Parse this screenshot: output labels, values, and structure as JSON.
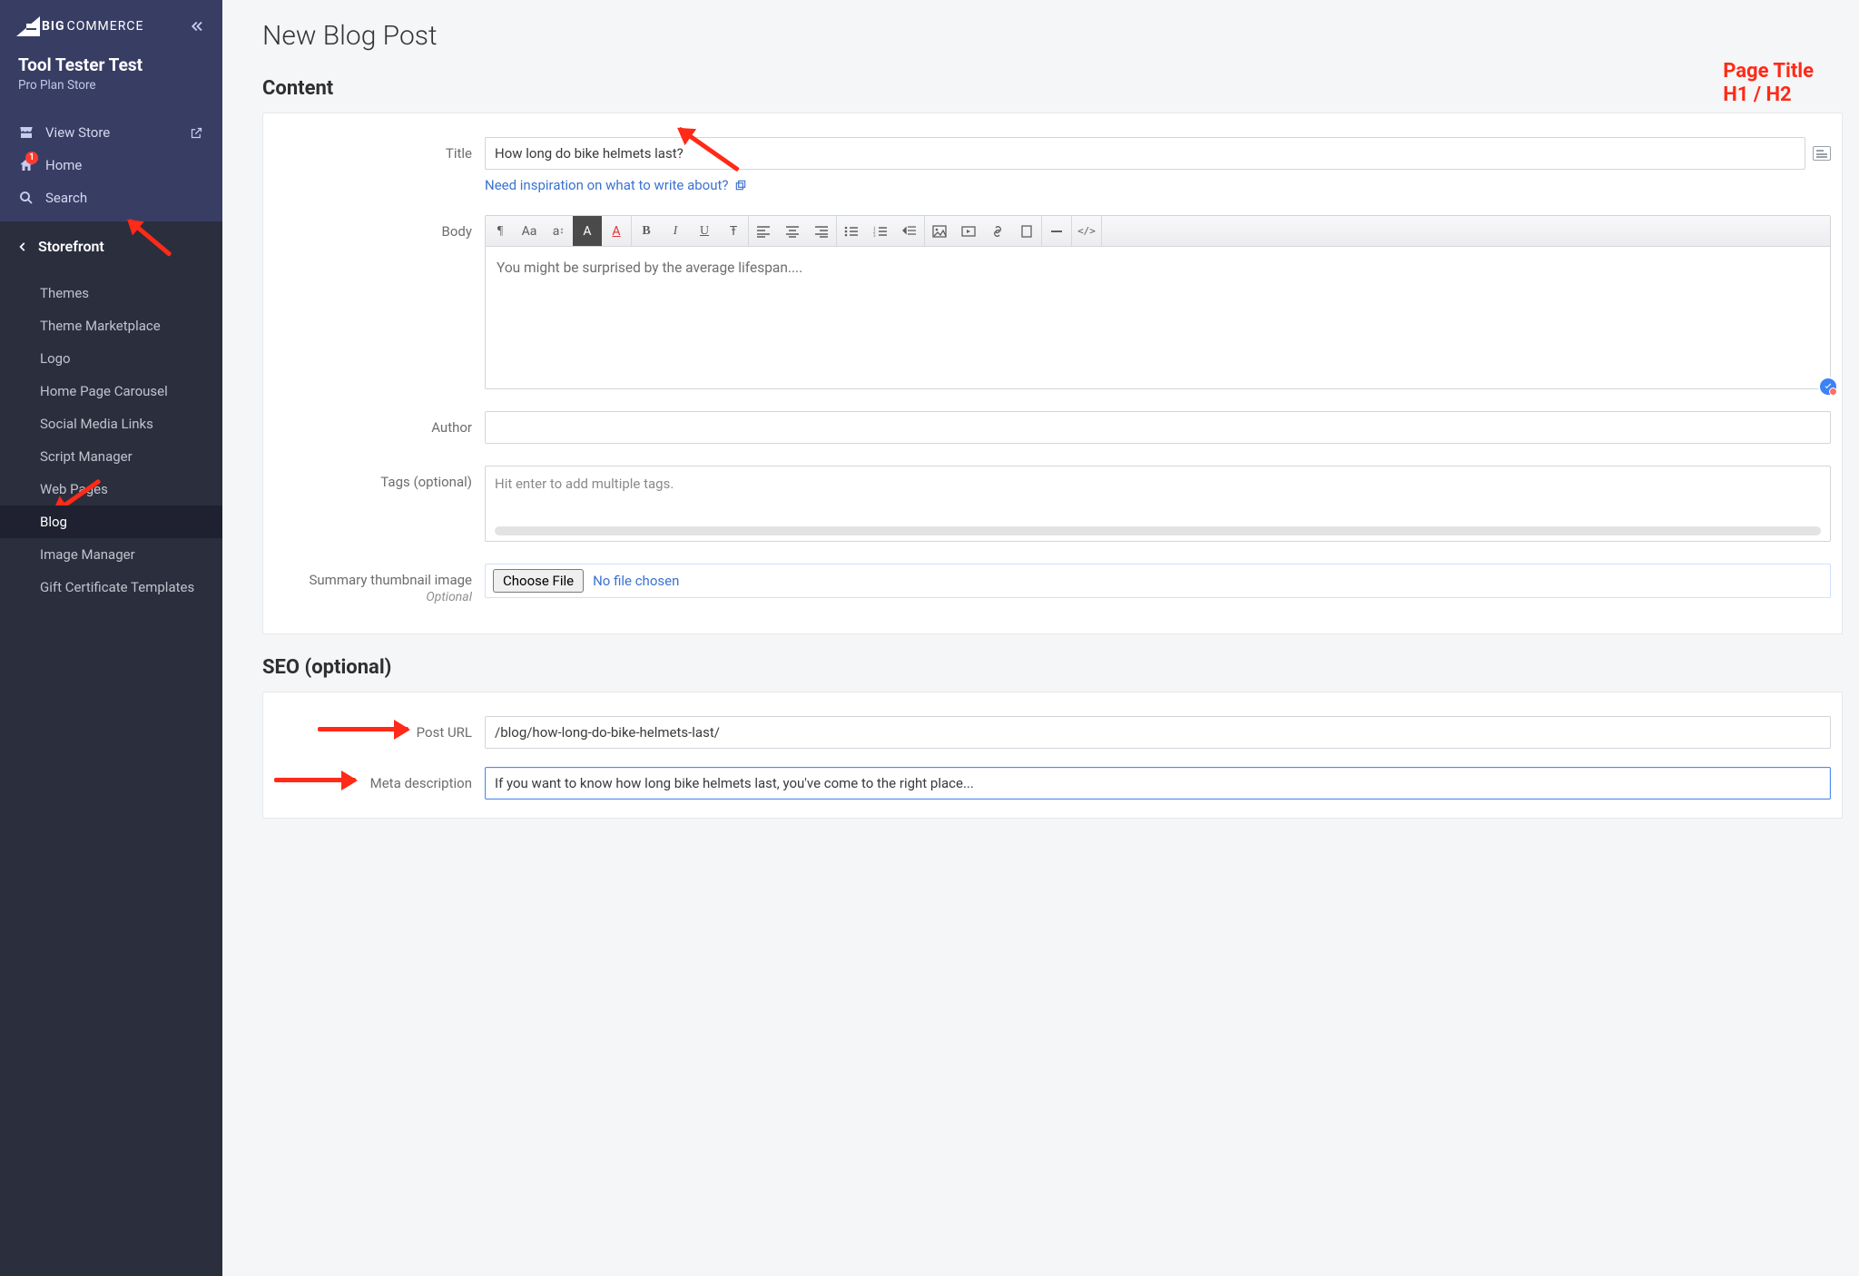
{
  "branding": {
    "logo_text_left": "BIG",
    "logo_text_right": "COMMERCE"
  },
  "store": {
    "name": "Tool Tester Test",
    "plan": "Pro Plan Store"
  },
  "primary_nav": {
    "view_store": "View Store",
    "home": "Home",
    "home_badge": "1",
    "search": "Search"
  },
  "sub_panel": {
    "header": "Storefront",
    "items": [
      "Themes",
      "Theme Marketplace",
      "Logo",
      "Home Page Carousel",
      "Social Media Links",
      "Script Manager",
      "Web Pages",
      "Blog",
      "Image Manager",
      "Gift Certificate Templates"
    ],
    "active_index": 7
  },
  "page": {
    "title": "New Blog Post",
    "sections": {
      "content": "Content",
      "seo": "SEO (optional)"
    },
    "fields": {
      "title_label": "Title",
      "title_value": "How long do bike helmets last?",
      "inspiration_link": "Need inspiration on what to write about?",
      "body_label": "Body",
      "body_text": "You might be surprised by the average lifespan....",
      "author_label": "Author",
      "author_value": "",
      "tags_label": "Tags (optional)",
      "tags_placeholder": "Hit enter to add multiple tags.",
      "thumb_label": "Summary thumbnail image",
      "thumb_sub": "Optional",
      "choose_file": "Choose File",
      "no_file": "No file chosen",
      "post_url_label": "Post URL",
      "post_url_value": "/blog/how-long-do-bike-helmets-last/",
      "meta_label": "Meta description",
      "meta_value": "If you want to know how long bike helmets last, you've come to the right place..."
    }
  },
  "annotations": {
    "callout_line1": "Page Title",
    "callout_line2": "H1 / H2"
  },
  "toolbar_icons": [
    "paragraph",
    "font-case",
    "font-size",
    "text-bg",
    "text-color",
    "bold",
    "italic",
    "underline",
    "strikethrough",
    "align-left",
    "align-center",
    "align-right",
    "list-ul",
    "list-ol",
    "outdent",
    "image",
    "video",
    "link",
    "page",
    "hr",
    "code"
  ]
}
